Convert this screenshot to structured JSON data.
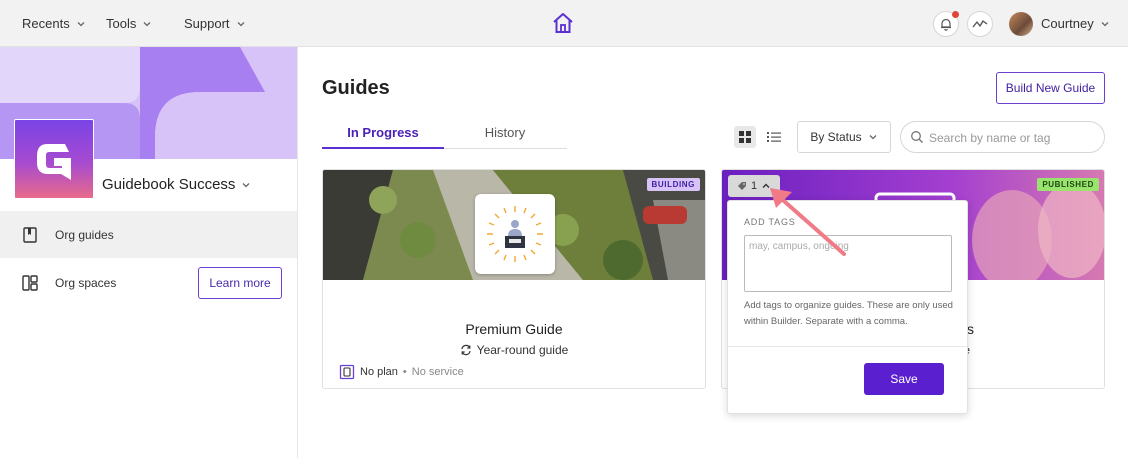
{
  "topnav": {
    "recents": "Recents",
    "tools": "Tools",
    "support": "Support",
    "user_name": "Courtney"
  },
  "sidebar": {
    "org_name": "Guidebook Success",
    "items": [
      {
        "label": "Org guides",
        "active": true
      },
      {
        "label": "Org spaces",
        "active": false
      }
    ],
    "learn_more": "Learn more"
  },
  "main": {
    "title": "Guides",
    "build_button": "Build New Guide",
    "tabs": [
      {
        "label": "In Progress",
        "active": true
      },
      {
        "label": "History",
        "active": false
      }
    ],
    "status_filter": "By Status",
    "search_placeholder": "Search by name or tag"
  },
  "cards": [
    {
      "badge": "BUILDING",
      "title": "Premium Guide",
      "subtitle": "Year-round guide",
      "plan": "No plan",
      "service": "No service"
    },
    {
      "badge": "PUBLISHED",
      "title_fragment": "s",
      "subtitle_fragment": "e"
    }
  ],
  "tag_popup": {
    "chip_count": "1",
    "title": "ADD TAGS",
    "placeholder": "may, campus, ongoing",
    "help": "Add tags to organize guides. These are only used within Builder. Separate with a comma.",
    "save": "Save"
  },
  "colors": {
    "accent": "#5a20d0",
    "building_badge": "#d7c3f7",
    "published_badge": "#9be36f"
  }
}
